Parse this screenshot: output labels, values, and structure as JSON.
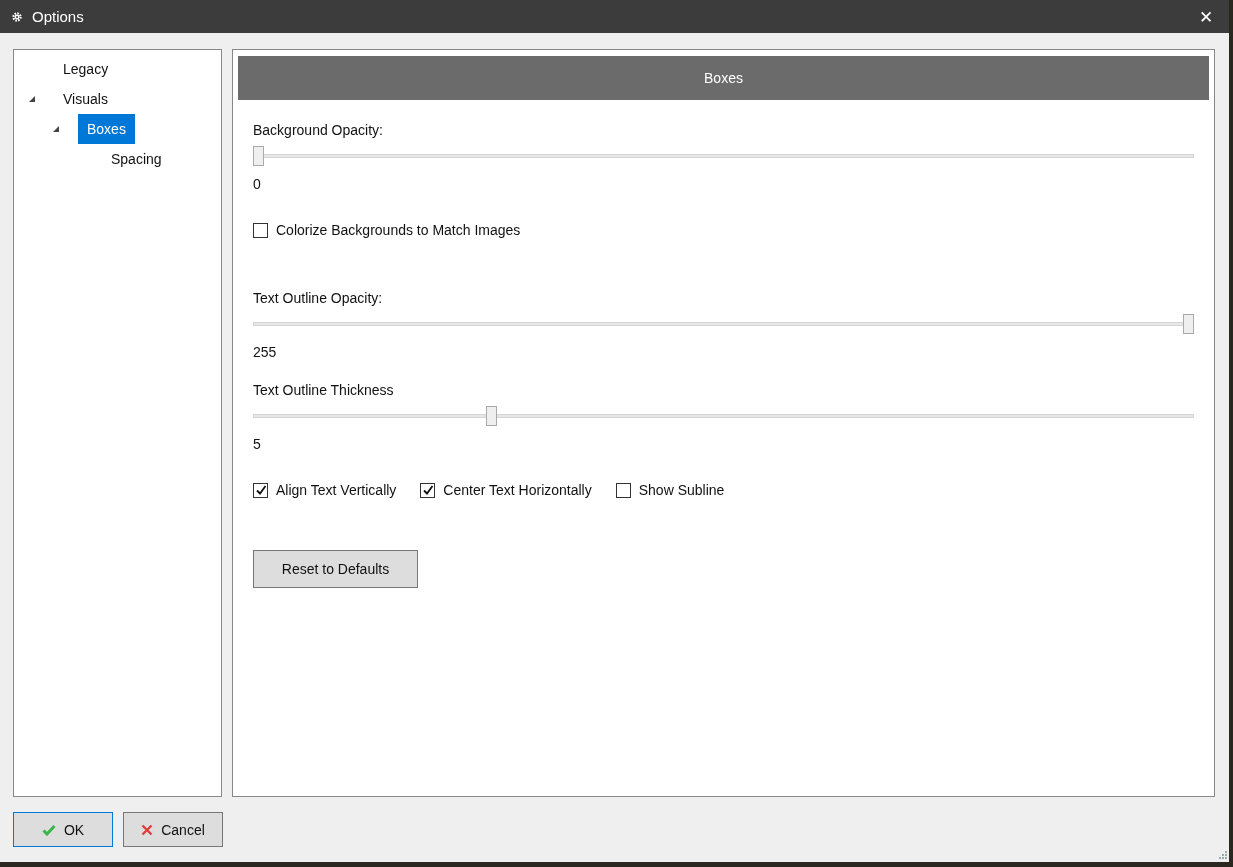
{
  "window": {
    "title": "Options",
    "close": "✕"
  },
  "tree": [
    {
      "label": "Legacy",
      "selected": false
    },
    {
      "label": "Visuals",
      "selected": false,
      "expanded": true,
      "children": [
        {
          "label": "Boxes",
          "selected": true,
          "expanded": true,
          "children": [
            {
              "label": "Spacing",
              "selected": false
            }
          ]
        }
      ]
    }
  ],
  "panel": {
    "title": "Boxes"
  },
  "controls": [
    {
      "kind": "slider",
      "label": "Background Opacity:",
      "level": 0,
      "reading": "0"
    },
    {
      "kind": "checkboxes",
      "items": [
        {
          "label": "Colorize Backgrounds to Match Images",
          "checked": false
        }
      ]
    },
    {
      "kind": "slider",
      "label": "Text Outline Opacity:",
      "level": 1,
      "reading": "255"
    },
    {
      "kind": "slider",
      "label": "Text Outline Thickness",
      "level": 0.25,
      "reading": "5"
    },
    {
      "kind": "checkboxes",
      "items": [
        {
          "label": "Align Text Vertically",
          "checked": true
        },
        {
          "label": "Center Text Horizontally",
          "checked": true
        },
        {
          "label": "Show Subline",
          "checked": false
        }
      ]
    },
    {
      "kind": "button",
      "label": "Reset to Defaults"
    }
  ],
  "buttons": [
    {
      "kind": "ok",
      "label": "OK"
    },
    {
      "kind": "cancel",
      "label": "Cancel"
    }
  ]
}
